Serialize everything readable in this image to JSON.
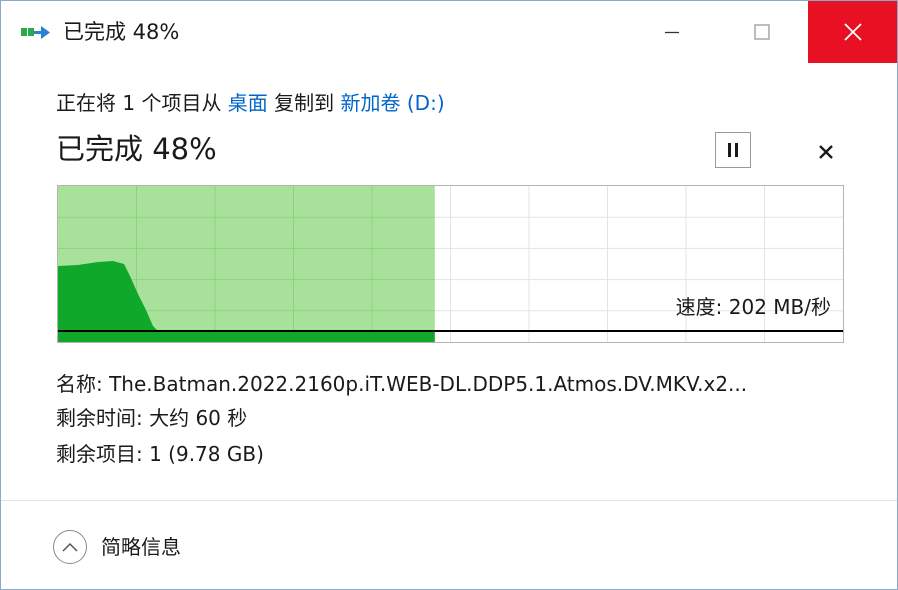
{
  "window": {
    "title": "已完成 48%",
    "minimize_label": "—",
    "maximize_label": "☐",
    "close_label": "✕"
  },
  "copy": {
    "prefix": "正在将 1 个项目从 ",
    "source": "桌面",
    "middle": " 复制到 ",
    "destination": "新加卷 (D:)"
  },
  "status": {
    "text": "已完成 48%",
    "percent_complete": 48
  },
  "controls": {
    "pause_icon": "pause-icon",
    "cancel_icon": "close-icon"
  },
  "graph": {
    "speed_label": "速度: 202 MB/秒",
    "progress_fraction": 0.48,
    "colors": {
      "progress_fill": "#a8e29a",
      "speed_fill": "#10a82a",
      "grid": "#cfe6cf",
      "grid_empty": "#dde5ec",
      "speed_line": "#000000"
    }
  },
  "details": {
    "name": "名称: The.Batman.2022.2160p.iT.WEB-DL.DDP5.1.Atmos.DV.MKV.x2...",
    "time_remaining": "剩余时间: 大约 60 秒",
    "items_remaining": "剩余项目: 1 (9.78 GB)"
  },
  "footer": {
    "collapse_label": "简略信息",
    "collapse_icon": "chevron-up-icon"
  },
  "colors": {
    "close_button_bg": "#e81123",
    "link": "#0066cc"
  }
}
